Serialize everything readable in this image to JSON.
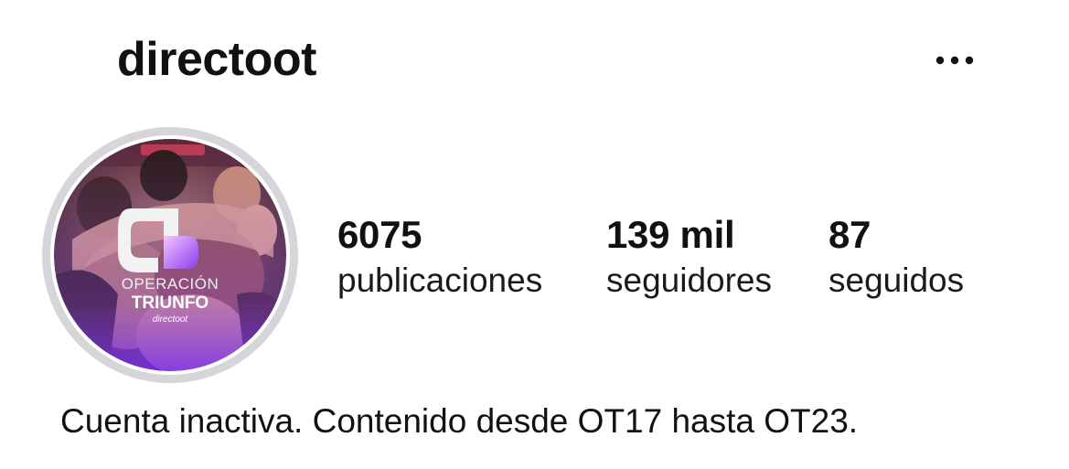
{
  "header": {
    "username": "directoot",
    "more_icon": "more-horizontal-icon"
  },
  "avatar": {
    "logo_line1": "OPERACIÓN",
    "logo_line2": "TRIUNFO",
    "logo_line3": "directoot",
    "accent": "#8a3df0",
    "ring_color": "#d6d6da"
  },
  "stats": {
    "posts": {
      "value": "6075",
      "label": "publicaciones"
    },
    "followers": {
      "value": "139 mil",
      "label": "seguidores"
    },
    "following": {
      "value": "87",
      "label": "seguidos"
    }
  },
  "bio": {
    "text": "Cuenta inactiva. Contenido desde OT17 hasta OT23."
  }
}
